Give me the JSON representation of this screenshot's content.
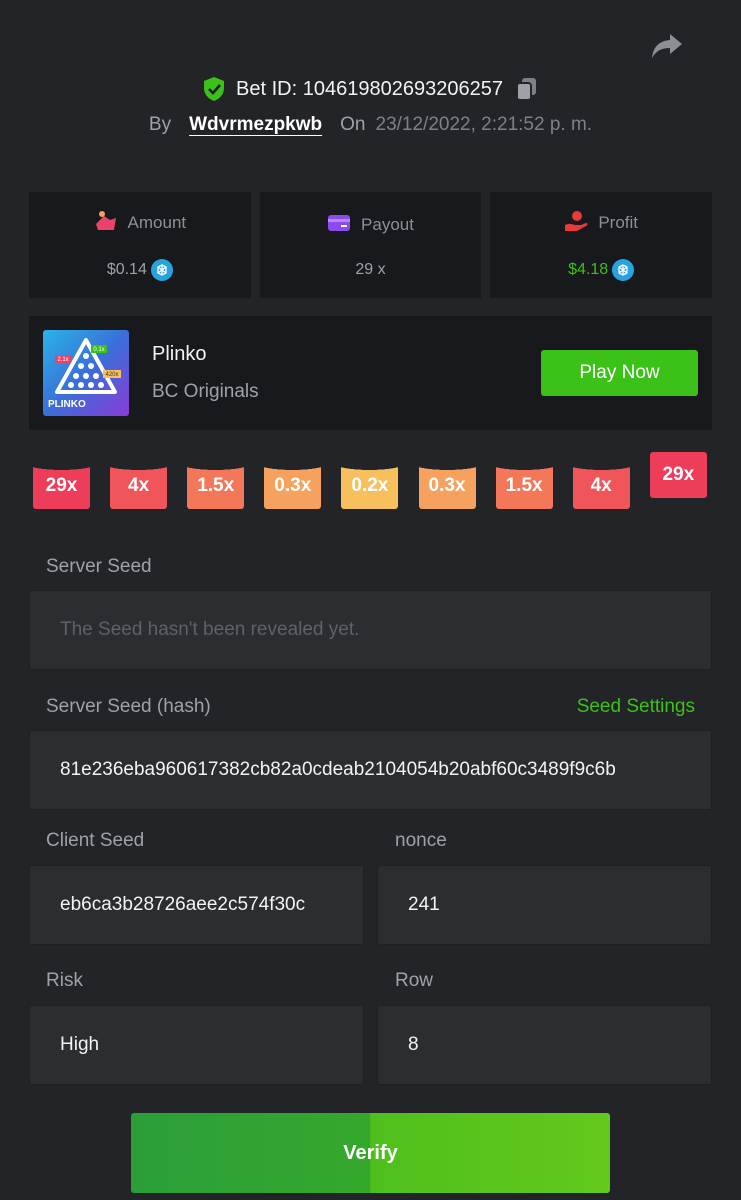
{
  "header": {
    "bet_id_label": "Bet ID: 104619802693206257",
    "by_label": "By",
    "username": "Wdvrmezpkwb",
    "on_label": "On",
    "datetime": "23/12/2022, 2:21:52 p. m."
  },
  "stats": {
    "amount": {
      "label": "Amount",
      "value": "$0.14"
    },
    "payout": {
      "label": "Payout",
      "value": "29 x"
    },
    "profit": {
      "label": "Profit",
      "value": "$4.18"
    }
  },
  "game": {
    "name": "Plinko",
    "provider": "BC Originals",
    "thumb_title": "PLINKO",
    "thumb_tags": [
      "2.1x",
      "0.1x",
      "420x"
    ],
    "play_label": "Play Now"
  },
  "multipliers": [
    {
      "label": "29x",
      "color": "#ee3d58"
    },
    {
      "label": "4x",
      "color": "#f0555a"
    },
    {
      "label": "1.5x",
      "color": "#f4775a"
    },
    {
      "label": "0.3x",
      "color": "#f6a25e"
    },
    {
      "label": "0.2x",
      "color": "#f7c05c"
    },
    {
      "label": "0.3x",
      "color": "#f6a25e"
    },
    {
      "label": "1.5x",
      "color": "#f4775a"
    },
    {
      "label": "4x",
      "color": "#f0555a"
    },
    {
      "label": "29x",
      "color": "#ee3d58"
    }
  ],
  "selected_multiplier_index": 8,
  "fields": {
    "server_seed": {
      "label": "Server Seed",
      "placeholder": "The Seed hasn't been revealed yet."
    },
    "server_seed_hash": {
      "label": "Server Seed (hash)",
      "value": "81e236eba960617382cb82a0cdeab2104054b20abf60c3489f9c6b",
      "link": "Seed Settings"
    },
    "client_seed": {
      "label": "Client Seed",
      "value": "eb6ca3b28726aee2c574f30c"
    },
    "nonce": {
      "label": "nonce",
      "value": "241"
    },
    "risk": {
      "label": "Risk",
      "value": "High"
    },
    "row": {
      "label": "Row",
      "value": "8"
    }
  },
  "verify_label": "Verify",
  "colors": {
    "background": "#232427",
    "panel": "#18191c",
    "field": "#2c2d31",
    "accent_green": "#3bc117",
    "coin_blue": "#27a3e0"
  }
}
